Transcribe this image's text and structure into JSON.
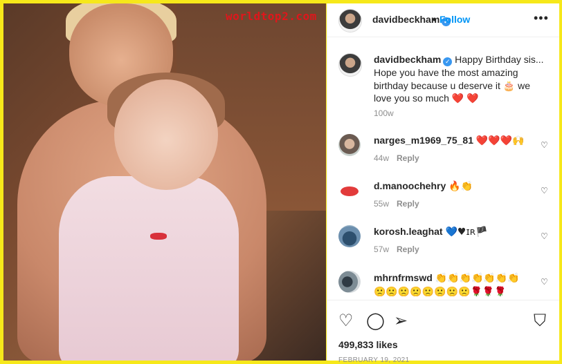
{
  "watermark": "worldtop2.com",
  "header": {
    "username": "davidbeckham",
    "separator": "•",
    "follow_label": "Follow",
    "more_label": "•••"
  },
  "caption": {
    "username": "davidbeckham",
    "text": "Happy Birthday sis... Hope you have the most amazing birthday because u deserve it 🎂 we love you so much ❤️ ❤️",
    "time": "100w"
  },
  "comments": [
    {
      "username": "narges_m1969_75_81",
      "text": "❤️❤️❤️🙌",
      "time": "44w",
      "reply": "Reply"
    },
    {
      "username": "d.manoochehry",
      "text": "🔥👏",
      "time": "55w",
      "reply": "Reply"
    },
    {
      "username": "korosh.leaghat",
      "text": "💙♥ɪʀ🏴",
      "time": "57w",
      "reply": "Reply"
    },
    {
      "username": "mhrnfrmswd",
      "text": "👏👏👏👏👏👏👏 🙁🙁🙁🙁🙁🙁🙁🙁🌹🌹🌹",
      "time": "",
      "reply": ""
    }
  ],
  "actions": {
    "like_icon": "heart-outline-icon",
    "comment_icon": "comment-icon",
    "share_icon": "paper-plane-icon",
    "save_icon": "bookmark-icon"
  },
  "likes": "499,833 likes",
  "date": "FEBRUARY 19, 2021",
  "colors": {
    "link": "#0095f6",
    "verified": "#3897f0",
    "heart": "#ed4956",
    "border": "#f6e81a"
  }
}
